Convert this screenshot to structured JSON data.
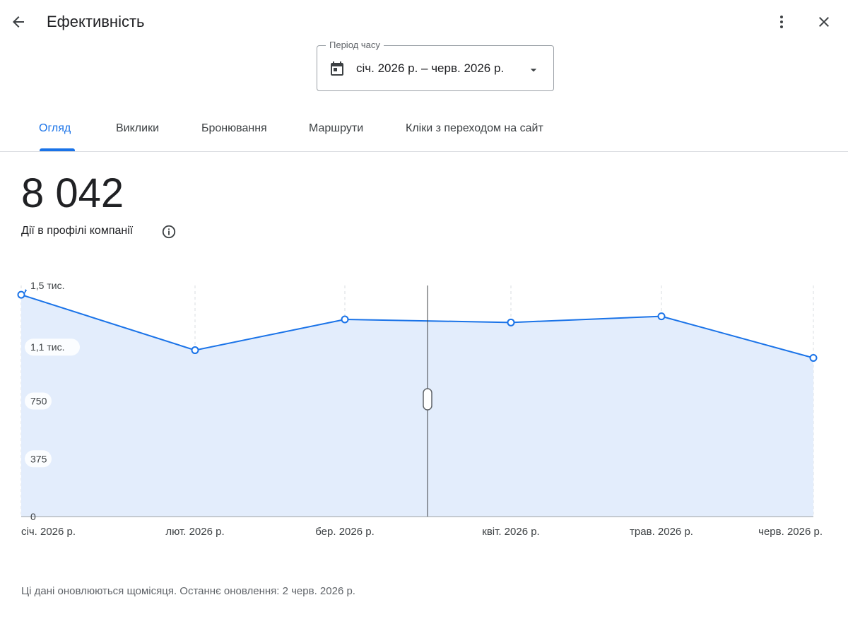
{
  "header": {
    "title": "Ефективність",
    "back_icon": "arrow-back-icon",
    "more_icon": "more-vert-icon",
    "close_icon": "close-icon"
  },
  "period": {
    "legend": "Період часу",
    "value": "січ. 2026 р. – черв. 2026 р.",
    "icon": "calendar-icon",
    "dropdown_icon": "arrow-drop-down-icon"
  },
  "tabs": [
    {
      "label": "Огляд",
      "active": true
    },
    {
      "label": "Виклики",
      "active": false
    },
    {
      "label": "Бронювання",
      "active": false
    },
    {
      "label": "Маршрути",
      "active": false
    },
    {
      "label": "Кліки з переходом на сайт",
      "active": false
    }
  ],
  "summary": {
    "total": "8 042",
    "label": "Дії в профілі компанії",
    "info_icon": "info-icon"
  },
  "chart_data": {
    "type": "area",
    "categories": [
      "січ. 2026 р.",
      "лют. 2026 р.",
      "бер. 2026 р.",
      "квіт. 2026 р.",
      "трав. 2026 р.",
      "черв. 2026 р."
    ],
    "values": [
      1440,
      1080,
      1280,
      1260,
      1300,
      1030
    ],
    "ylim": [
      0,
      1500
    ],
    "yticks": [
      {
        "value": 0,
        "label": "0"
      },
      {
        "value": 375,
        "label": "375"
      },
      {
        "value": 750,
        "label": "750"
      },
      {
        "value": 1100,
        "label": "1,1 тис."
      },
      {
        "value": 1500,
        "label": "1,5 тис."
      }
    ],
    "line_color": "#1a73e8",
    "fill_color": "#e3edfc",
    "grid": "vertical-dashed",
    "title": "",
    "xlabel": "",
    "ylabel": ""
  },
  "footer": {
    "note": "Ці дані оновлюються щомісяця. Останнє оновлення: 2 черв. 2026 р."
  }
}
